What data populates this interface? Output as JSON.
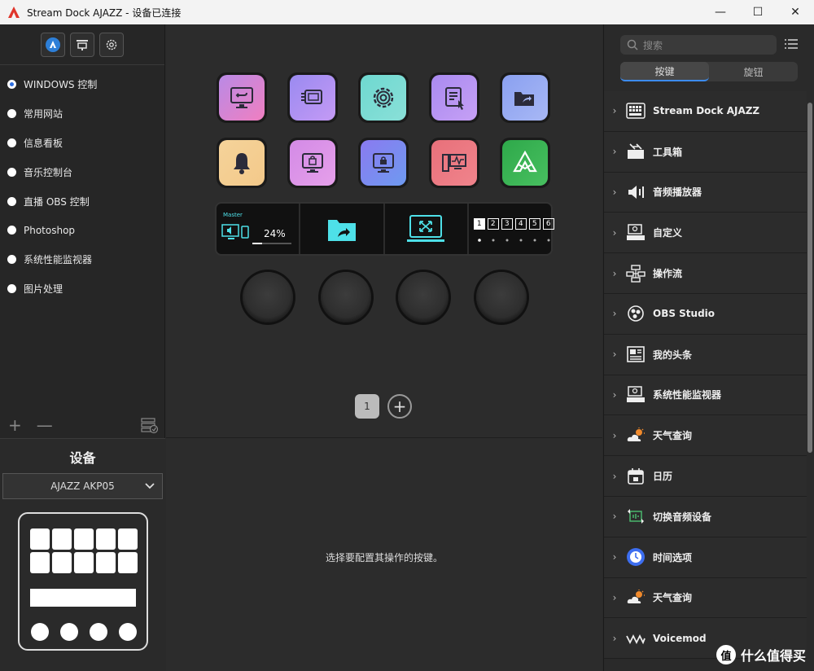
{
  "window": {
    "title": "Stream Dock AJAZZ - 设备已连接",
    "minimize": "—",
    "maximize": "☐",
    "close": "✕"
  },
  "profiles": [
    {
      "label": "WINDOWS 控制",
      "selected": true
    },
    {
      "label": "常用网站",
      "selected": false
    },
    {
      "label": "信息看板",
      "selected": false
    },
    {
      "label": "音乐控制台",
      "selected": false
    },
    {
      "label": "直播 OBS 控制",
      "selected": false
    },
    {
      "label": "Photoshop",
      "selected": false
    },
    {
      "label": "系统性能监视器",
      "selected": false
    },
    {
      "label": "图片处理",
      "selected": false
    }
  ],
  "left_tools": {
    "add": "+",
    "remove": "—"
  },
  "device": {
    "title": "设备",
    "selected": "AJAZZ AKP05"
  },
  "strip": {
    "master_label": "Master",
    "volume": "24%",
    "volume_fraction": 0.24,
    "pages": [
      "1",
      "2",
      "3",
      "4",
      "5",
      "6"
    ]
  },
  "pager": {
    "current": "1",
    "add": "+"
  },
  "hint": "选择要配置其操作的按键。",
  "right": {
    "search_placeholder": "搜索",
    "tabs": [
      {
        "label": "按键",
        "active": true
      },
      {
        "label": "旋钮",
        "active": false
      }
    ],
    "categories": [
      {
        "label": "Stream Dock AJAZZ",
        "icon": "keyboard-icon"
      },
      {
        "label": "工具箱",
        "icon": "toolbox-icon"
      },
      {
        "label": "音频播放器",
        "icon": "speaker-icon"
      },
      {
        "label": "自定义",
        "icon": "custom-icon"
      },
      {
        "label": "操作流",
        "icon": "flow-icon"
      },
      {
        "label": "OBS Studio",
        "icon": "obs-icon"
      },
      {
        "label": "我的头条",
        "icon": "news-icon"
      },
      {
        "label": "系统性能监视器",
        "icon": "monitor-icon"
      },
      {
        "label": "天气查询",
        "icon": "weather-icon"
      },
      {
        "label": "日历",
        "icon": "calendar-icon"
      },
      {
        "label": "切换音频设备",
        "icon": "audio-switch-icon"
      },
      {
        "label": "时间选项",
        "icon": "clock-icon"
      },
      {
        "label": "天气查询",
        "icon": "weather-icon"
      },
      {
        "label": "Voicemod",
        "icon": "voicemod-icon"
      }
    ]
  },
  "watermark": {
    "logo": "值",
    "text": "什么值得买"
  },
  "colors": {
    "accent": "#3c8cf0",
    "selected_radio": "#2d6ee0"
  }
}
